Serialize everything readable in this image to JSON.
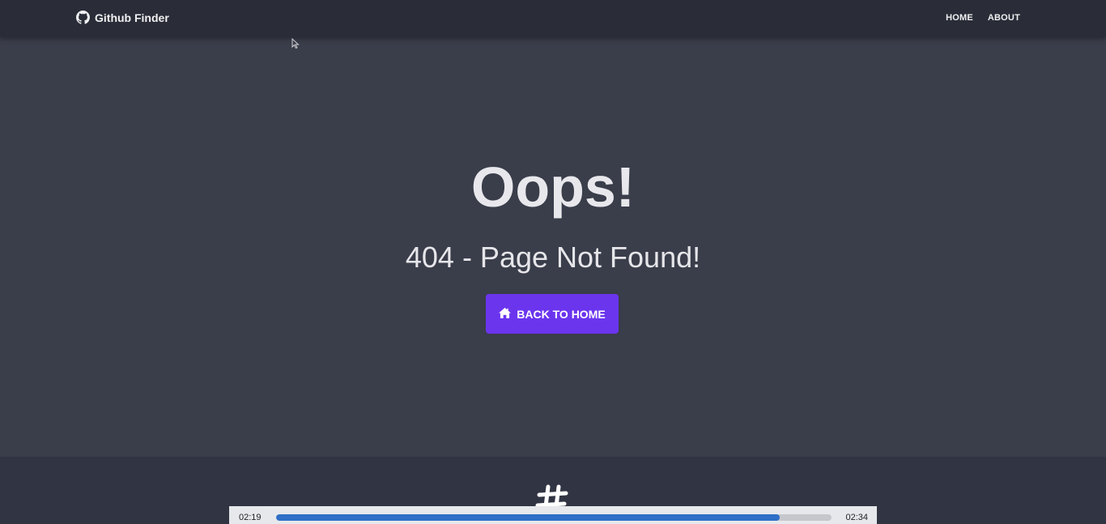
{
  "navbar": {
    "brand": "Github Finder",
    "brand_icon": "github-icon",
    "links": [
      "HOME",
      "ABOUT"
    ]
  },
  "hero": {
    "title": "Oops!",
    "subtitle": "404 - Page Not Found!",
    "button_label": "BACK TO HOME",
    "button_icon": "home-icon",
    "button_color": "#6b35ee"
  },
  "footer": {
    "icon": "hashtag-icon"
  },
  "player": {
    "elapsed": "02:19",
    "total": "02:34",
    "progress_percent": 90.6
  },
  "colors": {
    "navbar_bg": "#2a2d38",
    "page_bg": "#3a3d4a",
    "footer_bg": "#313543",
    "progress": "#2f6fc7"
  }
}
